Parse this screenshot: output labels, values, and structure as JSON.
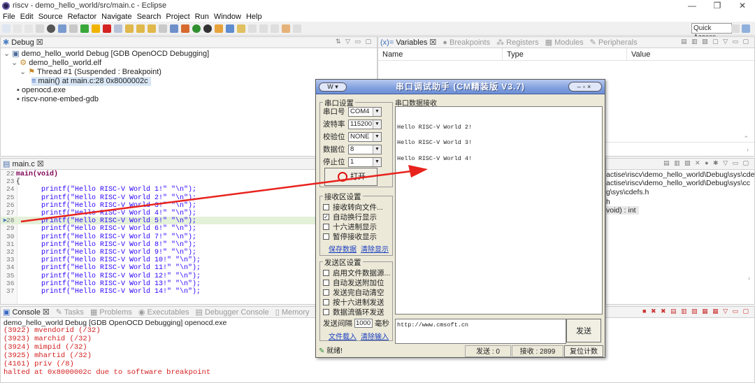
{
  "window": {
    "title": "riscv - demo_hello_world/src/main.c - Eclipse",
    "controls": [
      "—",
      "❐",
      "✕"
    ]
  },
  "menu": [
    "File",
    "Edit",
    "Source",
    "Refactor",
    "Navigate",
    "Search",
    "Project",
    "Run",
    "Window",
    "Help"
  ],
  "toolbar": {
    "quick_access": "Quick Access"
  },
  "debug": {
    "tab": "Debug ☒",
    "tree": [
      "demo_hello_world Debug [GDB OpenOCD Debugging]",
      "demo_hello_world.elf",
      "Thread #1 (Suspended : Breakpoint)",
      "main() at main.c:28 0x8000002c",
      "openocd.exe",
      "riscv-none-embed-gdb"
    ]
  },
  "variables": {
    "tabs": [
      "Variables ☒",
      "Breakpoints",
      "Registers",
      "Modules",
      "Peripherals"
    ],
    "columns": [
      "Name",
      "Type",
      "Value"
    ]
  },
  "editor": {
    "tab": "main.c ☒",
    "lines": [
      {
        "n": "22",
        "t": "main(void)"
      },
      {
        "n": "23",
        "t": "{"
      },
      {
        "n": "24",
        "t": "printf(\"Hello RISC-V World 1!\" \"\\n\");"
      },
      {
        "n": "25",
        "t": "printf(\"Hello RISC-V World 2!\" \"\\n\");"
      },
      {
        "n": "26",
        "t": "printf(\"Hello RISC-V World 3!\" \"\\n\");"
      },
      {
        "n": "27",
        "t": "printf(\"Hello RISC-V World 4!\" \"\\n\");"
      },
      {
        "n": "28",
        "t": "printf(\"Hello RISC-V World 5!\" \"\\n\");"
      },
      {
        "n": "29",
        "t": "printf(\"Hello RISC-V World 6!\" \"\\n\");"
      },
      {
        "n": "30",
        "t": "printf(\"Hello RISC-V World 7!\" \"\\n\");"
      },
      {
        "n": "31",
        "t": "printf(\"Hello RISC-V World 8!\" \"\\n\");"
      },
      {
        "n": "32",
        "t": "printf(\"Hello RISC-V World 9!\" \"\\n\");"
      },
      {
        "n": "33",
        "t": "printf(\"Hello RISC-V World 10!\" \"\\n\");"
      },
      {
        "n": "34",
        "t": "printf(\"Hello RISC-V World 11!\" \"\\n\");"
      },
      {
        "n": "35",
        "t": "printf(\"Hello RISC-V World 12!\" \"\\n\");"
      },
      {
        "n": "36",
        "t": "printf(\"Hello RISC-V World 13!\" \"\\n\");"
      },
      {
        "n": "37",
        "t": "printf(\"Hello RISC-V World 14!\" \"\\n\");"
      }
    ]
  },
  "outline": [
    "actise\\riscv\\demo_hello_world\\Debug\\sys\\cdefs.h",
    "actise\\riscv\\demo_hello_world\\Debug\\sys\\cc",
    "g\\sys\\cdefs.h",
    "h",
    "void) : int"
  ],
  "console": {
    "tabs": [
      "Console ☒",
      "Tasks",
      "Problems",
      "Executables",
      "Debugger Console",
      "Memory"
    ],
    "header": "demo_hello_world Debug [GDB OpenOCD Debugging] openocd.exe",
    "lines": [
      "(3922) mvendorid (/32)",
      "(3923) marchid (/32)",
      "(3924) mimpid (/32)",
      "(3925) mhartid (/32)",
      "(4161) priv (/8)",
      "halted at 0x8000002c due to software breakpoint"
    ]
  },
  "serial": {
    "title": "串口调试助手 (CM精装版 V3.7)",
    "port_group": "串口设置",
    "fields": [
      {
        "label": "串口号",
        "value": "COM4"
      },
      {
        "label": "波特率",
        "value": "115200"
      },
      {
        "label": "校验位",
        "value": "NONE"
      },
      {
        "label": "数据位",
        "value": "8"
      },
      {
        "label": "停止位",
        "value": "1"
      }
    ],
    "open_button": "打开",
    "recv_group": "接收区设置",
    "recv_options": [
      {
        "label": "接收转向文件...",
        "checked": ""
      },
      {
        "label": "自动换行显示",
        "checked": "✓"
      },
      {
        "label": "十六进制显示",
        "checked": ""
      },
      {
        "label": "暂停接收显示",
        "checked": ""
      }
    ],
    "recv_links": [
      "保存数据",
      "清除显示"
    ],
    "send_group": "发送区设置",
    "send_options": [
      {
        "label": "启用文件数据源...",
        "checked": ""
      },
      {
        "label": "自动发送附加位",
        "checked": ""
      },
      {
        "label": "发送完自动清空",
        "checked": ""
      },
      {
        "label": "按十六进制发送",
        "checked": ""
      },
      {
        "label": "数据流循环发送",
        "checked": ""
      }
    ],
    "interval_label": "发送间隔",
    "interval_value": "1000",
    "interval_unit": "毫秒",
    "send_links": [
      "文件载入",
      "清除输入"
    ],
    "recv_header": "串口数据接收",
    "recv_lines": [
      "Hello RISC-V World 2!",
      "Hello RISC-V World 3!",
      "Hello RISC-V World 4!"
    ],
    "send_text": "http://www.cmsoft.cn",
    "send_button": "发送",
    "status": {
      "ready": "就绪!",
      "sent": "发送 : 0",
      "recv": "接收 : 2899",
      "reset": "复位计数"
    }
  },
  "colors": {
    "arrow": "#e8231e",
    "console_error": "#d32020",
    "current_line": "#e3f1d9",
    "xp_title": "#7f9fde"
  }
}
